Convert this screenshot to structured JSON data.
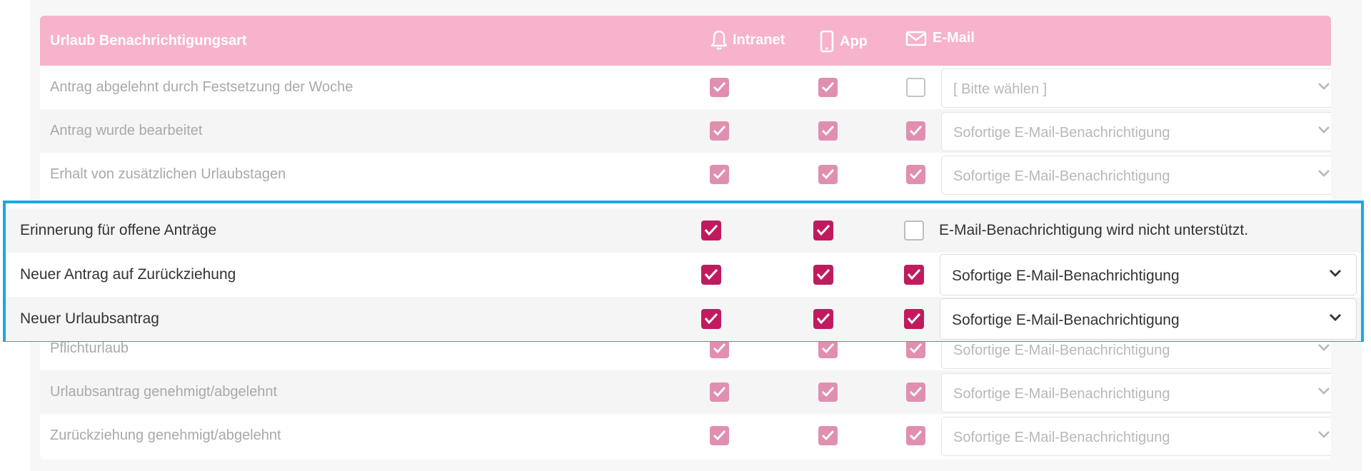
{
  "header": {
    "title": "Urlaub Benachrichtigungsart",
    "columns": [
      {
        "label": "Intranet",
        "icon": "bell-icon"
      },
      {
        "label": "App",
        "icon": "smartphone-icon"
      },
      {
        "label": "E-Mail",
        "icon": "mail-icon"
      }
    ]
  },
  "colors": {
    "header_bg": "#f7b2cc",
    "checked_faded": "#e08fb1",
    "checked_active": "#c01b5e",
    "highlight_border": "#1aa9e0"
  },
  "rows_top": [
    {
      "label": "Antrag abgelehnt durch Festsetzung der Woche",
      "intranet": true,
      "app": true,
      "email": false,
      "select": "[ Bitte wählen ]"
    },
    {
      "label": "Antrag wurde bearbeitet",
      "intranet": true,
      "app": true,
      "email": true,
      "select": "Sofortige E-Mail-Benachrichtigung"
    },
    {
      "label": "Erhalt von zusätzlichen Urlaubstagen",
      "intranet": true,
      "app": true,
      "email": true,
      "select": "Sofortige E-Mail-Benachrichtigung"
    }
  ],
  "rows_highlight": [
    {
      "label": "Erinnerung für offene Anträge",
      "intranet": true,
      "app": true,
      "email": false,
      "note": "E-Mail-Benachrichtigung wird nicht unterstützt."
    },
    {
      "label": "Neuer Antrag auf Zurückziehung",
      "intranet": true,
      "app": true,
      "email": true,
      "select": "Sofortige E-Mail-Benachrichtigung"
    },
    {
      "label": "Neuer Urlaubsantrag",
      "intranet": true,
      "app": true,
      "email": true,
      "select": "Sofortige E-Mail-Benachrichtigung"
    }
  ],
  "rows_bottom": [
    {
      "label": "Pflichturlaub",
      "intranet": true,
      "app": true,
      "email": true,
      "select": "Sofortige E-Mail-Benachrichtigung"
    },
    {
      "label": "Urlaubsantrag genehmigt/abgelehnt",
      "intranet": true,
      "app": true,
      "email": true,
      "select": "Sofortige E-Mail-Benachrichtigung"
    },
    {
      "label": "Zurückziehung genehmigt/abgelehnt",
      "intranet": true,
      "app": true,
      "email": true,
      "select": "Sofortige E-Mail-Benachrichtigung"
    }
  ]
}
